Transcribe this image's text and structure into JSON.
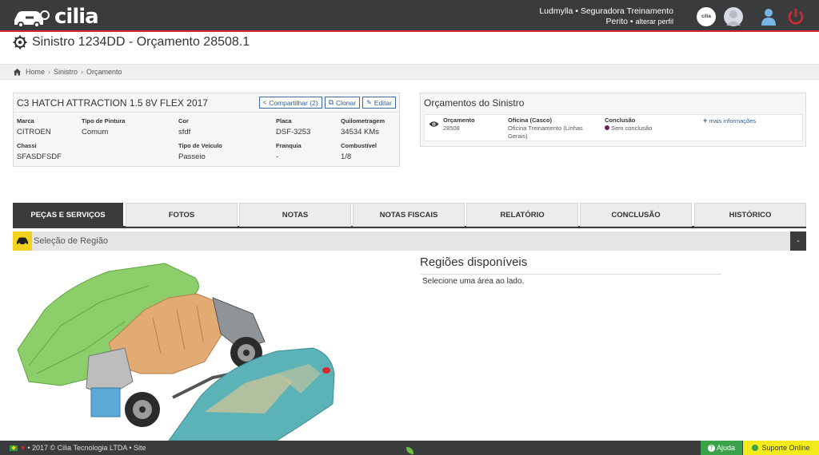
{
  "header": {
    "brand": "cilia",
    "user_line": "Ludmylla • Seguradora Treinamento",
    "role": "Perito",
    "change_profile": "alterar perfil",
    "mini_logo": "cilia"
  },
  "page": {
    "title": "Sinistro 1234DD - Orçamento 28508.1"
  },
  "breadcrumb": {
    "items": [
      "Home",
      "Sinistro",
      "Orçamento"
    ]
  },
  "vehicle": {
    "name": "C3 HATCH ATTRACTION 1.5 8V FLEX 2017",
    "buttons": {
      "share": "Compartilhar (2)",
      "clone": "Clonar",
      "edit": "Editar"
    },
    "fields": [
      {
        "label": "Marca",
        "value": "CITROEN"
      },
      {
        "label": "Tipo de Pintura",
        "value": "Comum"
      },
      {
        "label": "Cor",
        "value": "sfdf"
      },
      {
        "label": "Placa",
        "value": "DSF-3253"
      },
      {
        "label": "Quilometragem",
        "value": "34534 KMs"
      },
      {
        "label": "Chassi",
        "value": "SFASDFSDF"
      },
      {
        "label": "Tipo de Veículo",
        "value": "Passeio"
      },
      {
        "label": "Franquia",
        "value": "-"
      },
      {
        "label": "Combustível",
        "value": "1/8"
      }
    ]
  },
  "orcamentos": {
    "title": "Orçamentos do Sinistro",
    "orcamento_label": "Orçamento",
    "orcamento_value": "28508",
    "oficina_label": "Oficina (Casco)",
    "oficina_value": "Oficina Treinamento (Linhas Gerais)",
    "conclusao_label": "Conclusão",
    "conclusao_value": "Sem conclusão",
    "more": "mais informações",
    "status_color": "#6b1f5a"
  },
  "tabs": [
    {
      "label": "PEÇAS E SERVIÇOS",
      "active": true
    },
    {
      "label": "FOTOS"
    },
    {
      "label": "NOTAS"
    },
    {
      "label": "NOTAS FISCAIS"
    },
    {
      "label": "RELATÓRIO"
    },
    {
      "label": "CONCLUSÃO"
    },
    {
      "label": "HISTÓRICO"
    }
  ],
  "region": {
    "section_label": "Seleção de Região",
    "collapse": "-",
    "available_title": "Regiões disponíveis",
    "hint": "Selecione uma área ao lado."
  },
  "footer": {
    "text": "• 2017 © Cilia Tecnologia LTDA • Site",
    "help": "Ajuda",
    "support": "Suporte Online"
  },
  "colors": {
    "topbar": "#3a3b3d",
    "accent_red": "#d7292f",
    "accent_yellow": "#f2d31b",
    "help_green": "#3aa34a"
  }
}
